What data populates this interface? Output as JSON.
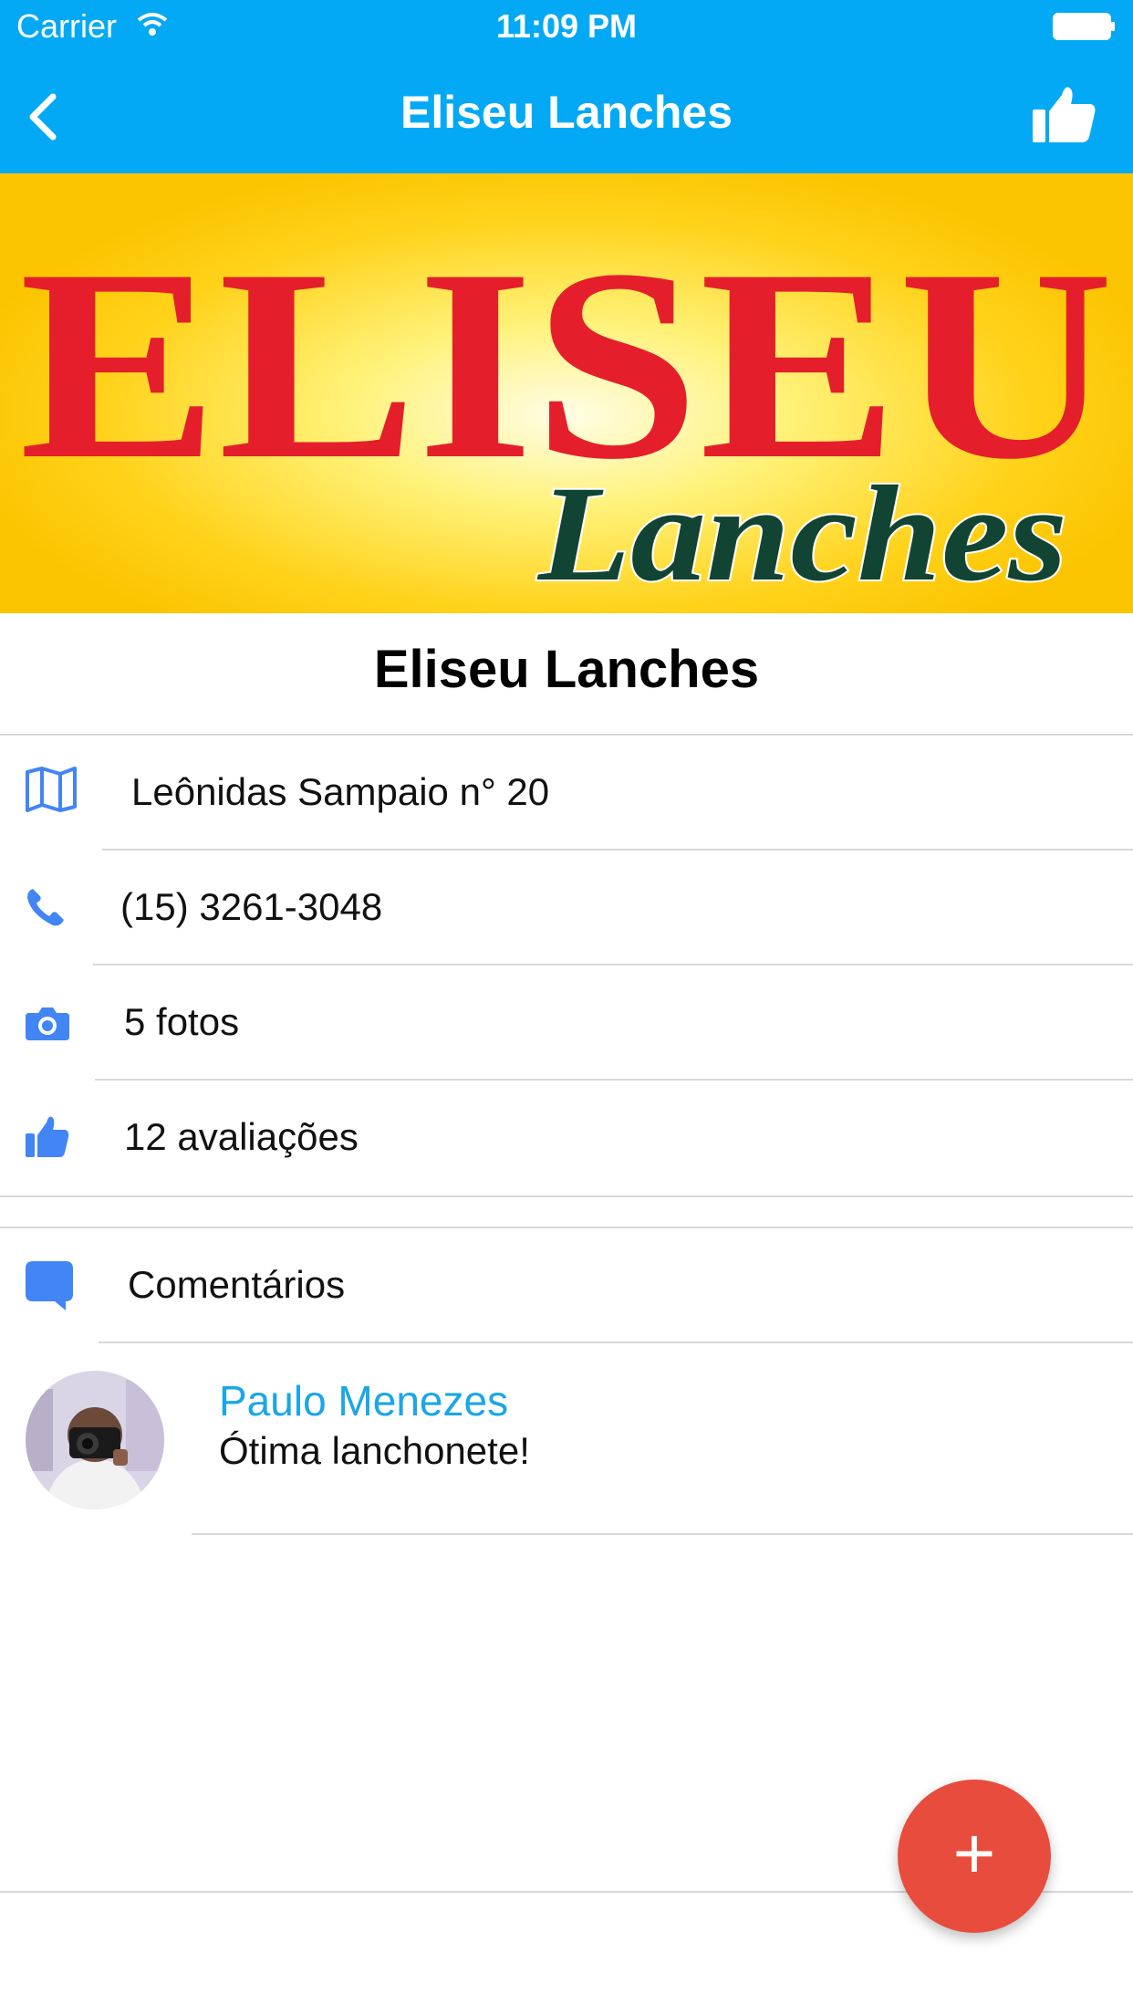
{
  "status_bar": {
    "carrier": "Carrier",
    "time": "11:09 PM"
  },
  "nav": {
    "title": "Eliseu Lanches",
    "back_icon": "chevron-left-icon",
    "like_icon": "thumbs-up-icon"
  },
  "banner": {
    "logo_line1": "ELISEU",
    "logo_line2": "Lanches",
    "page_dots": 4,
    "active_dot": 0
  },
  "place": {
    "name": "Eliseu Lanches"
  },
  "info_rows": [
    {
      "icon": "map-icon",
      "text": "Leônidas Sampaio n° 20"
    },
    {
      "icon": "phone-icon",
      "text": "(15) 3261-3048"
    },
    {
      "icon": "camera-icon",
      "text": "5 fotos"
    },
    {
      "icon": "thumbs-up-icon",
      "text": "12 avaliações"
    }
  ],
  "comments_section": {
    "icon": "comment-icon",
    "label": "Comentários"
  },
  "comments": [
    {
      "author": "Paulo Menezes",
      "text": "Ótima lanchonete!"
    }
  ],
  "fab": {
    "label": "+"
  },
  "colors": {
    "primary": "#03a9f4",
    "icon": "#4285f4",
    "fab": "#e84c3d",
    "link": "#1aa6e8"
  }
}
